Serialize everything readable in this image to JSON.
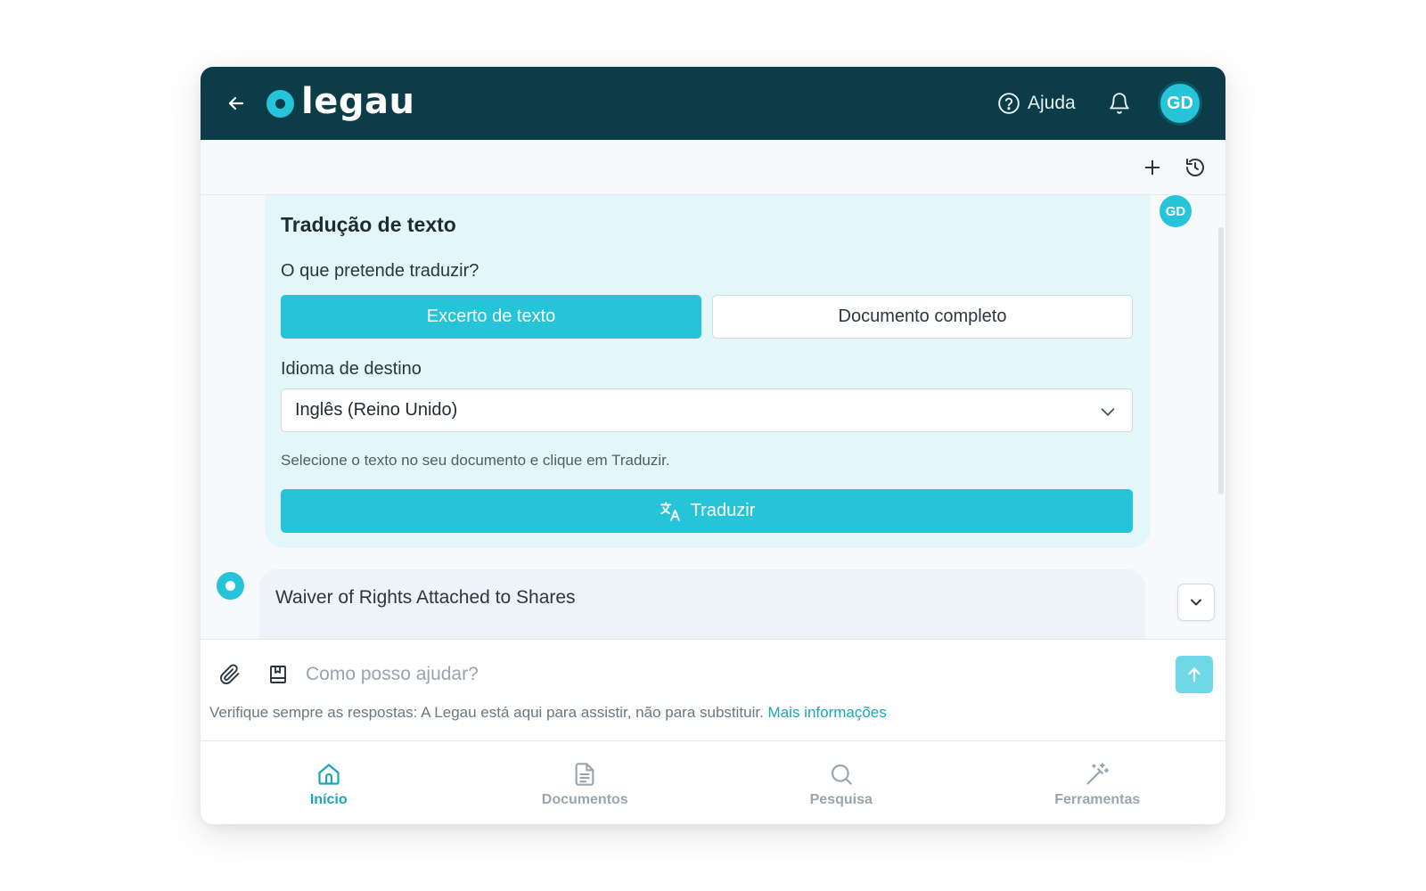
{
  "header": {
    "logo_text": "legau",
    "help_label": "Ajuda",
    "avatar_initials": "GD"
  },
  "translate_card": {
    "title": "Tradução de texto",
    "question": "O que pretende traduzir?",
    "options": [
      {
        "label": "Excerto de texto",
        "selected": true
      },
      {
        "label": "Documento completo",
        "selected": false
      }
    ],
    "language_label": "Idioma de destino",
    "language_selected": "Inglês (Reino Unido)",
    "hint": "Selecione o texto no seu documento e clique em Traduzir.",
    "translate_button": "Traduzir"
  },
  "user_avatar_initials": "GD",
  "assistant_message": {
    "text": "Waiver of Rights Attached to Shares"
  },
  "composer": {
    "placeholder": "Como posso ajudar?",
    "value": "",
    "disclaimer": "Verifique sempre as respostas: A Legau está aqui para assistir, não para substituir.",
    "disclaimer_link": "Mais informações"
  },
  "bottom_nav": {
    "items": [
      {
        "label": "Início",
        "icon": "home-icon",
        "active": true
      },
      {
        "label": "Documentos",
        "icon": "document-icon",
        "active": false
      },
      {
        "label": "Pesquisa",
        "icon": "search-icon",
        "active": false
      },
      {
        "label": "Ferramentas",
        "icon": "magic-wand-icon",
        "active": false
      }
    ]
  },
  "colors": {
    "header_bg": "#0b3c48",
    "accent": "#26c4d9",
    "card_bg": "#e3f7fb",
    "link": "#1aa6ba"
  }
}
